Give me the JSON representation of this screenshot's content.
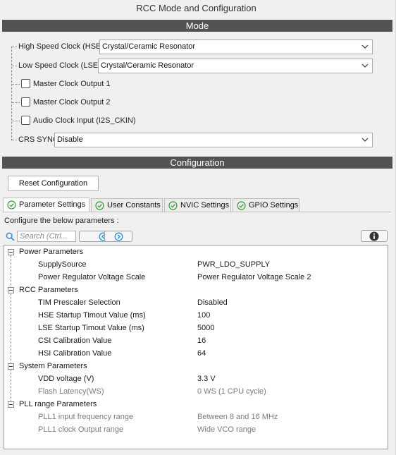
{
  "window": {
    "title": "RCC Mode and Configuration"
  },
  "mode": {
    "header": "Mode",
    "hse": {
      "label": "High Speed Clock (HSE)",
      "value": "Crystal/Ceramic Resonator"
    },
    "lse": {
      "label": "Low Speed Clock (LSE)",
      "value": "Crystal/Ceramic Resonator"
    },
    "mco1": {
      "label": "Master Clock Output 1"
    },
    "mco2": {
      "label": "Master Clock Output 2"
    },
    "i2s": {
      "label": "Audio Clock Input (I2S_CKIN)"
    },
    "crs": {
      "label": "CRS SYNC",
      "value": "Disable"
    }
  },
  "configuration": {
    "header": "Configuration",
    "reset_label": "Reset Configuration",
    "tabs": [
      {
        "label": "Parameter Settings"
      },
      {
        "label": "User Constants"
      },
      {
        "label": "NVIC Settings"
      },
      {
        "label": "GPIO Settings"
      }
    ],
    "instruction": "Configure the below parameters :",
    "search_placeholder": "Search (Ctrl...",
    "groups": [
      {
        "name": "Power Parameters",
        "items": [
          {
            "label": "SupplySource",
            "value": "PWR_LDO_SUPPLY"
          },
          {
            "label": "Power Regulator Voltage Scale",
            "value": "Power Regulator Voltage Scale 2"
          }
        ]
      },
      {
        "name": "RCC Parameters",
        "items": [
          {
            "label": "TIM Prescaler Selection",
            "value": "Disabled"
          },
          {
            "label": "HSE Startup Timout Value (ms)",
            "value": "100"
          },
          {
            "label": "LSE Startup Timout Value (ms)",
            "value": "5000"
          },
          {
            "label": "CSI Calibration Value",
            "value": "16"
          },
          {
            "label": "HSI Calibration Value",
            "value": "64"
          }
        ]
      },
      {
        "name": "System Parameters",
        "items": [
          {
            "label": "VDD voltage (V)",
            "value": "3.3 V"
          },
          {
            "label": "Flash Latency(WS)",
            "value": "0 WS (1 CPU cycle)"
          }
        ]
      },
      {
        "name": "PLL range Parameters",
        "items": [
          {
            "label": "PLL1 input frequency range",
            "value": "Between 8 and 16 MHz"
          },
          {
            "label": "PLL1 clock Output range",
            "value": "Wide VCO range"
          }
        ]
      }
    ]
  },
  "colors": {
    "header_bar": "#535353",
    "tab_check": "#3a9a3a",
    "nav_icon": "#2f8fd0"
  },
  "icons": {
    "dropdown": "chevron-down-icon",
    "tab_status": "check-circle-icon",
    "search": "search-icon",
    "prev": "arrow-left-circle-icon",
    "next": "arrow-right-circle-icon",
    "info": "info-icon"
  }
}
